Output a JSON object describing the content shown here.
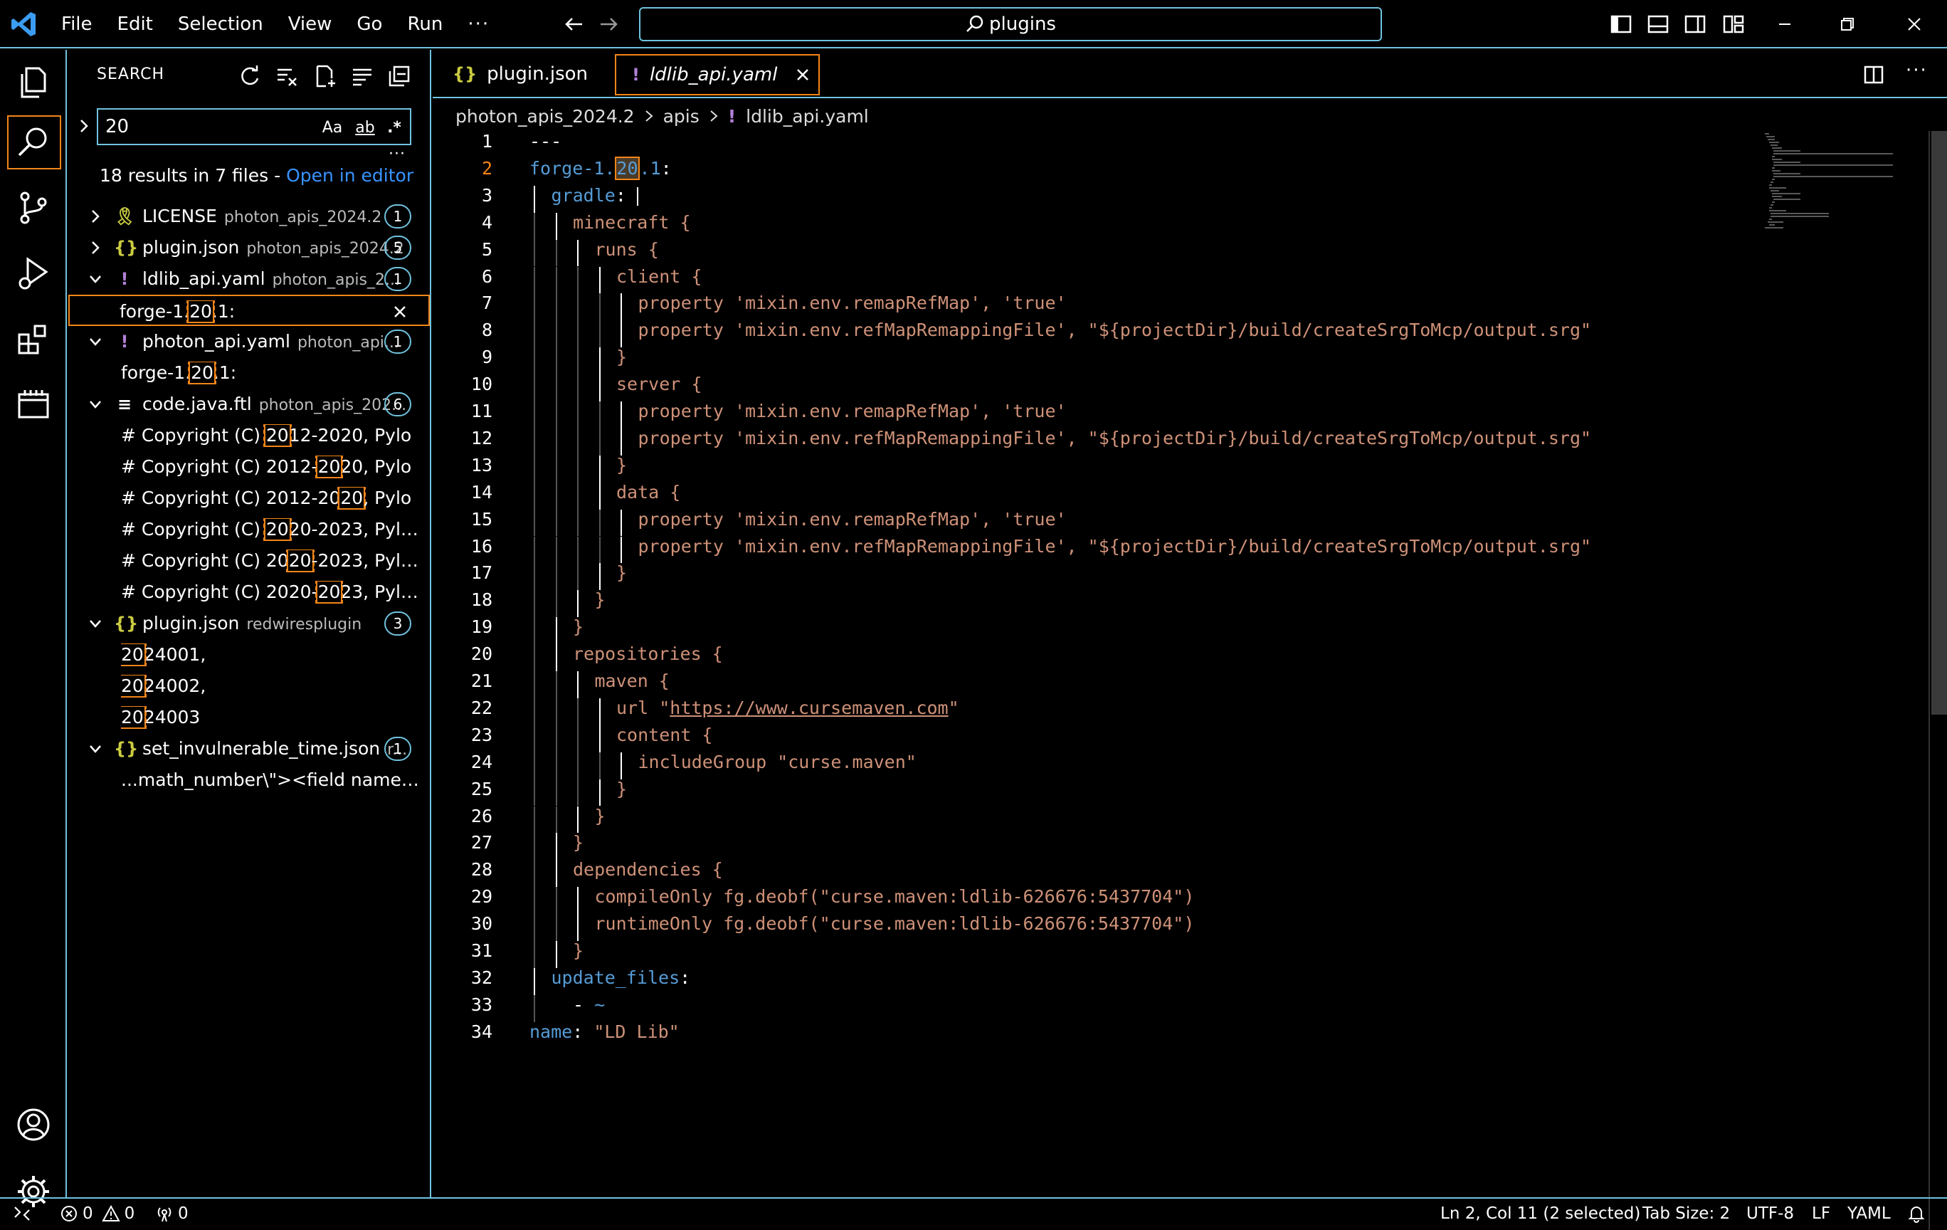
{
  "titlebar": {
    "menu": [
      "File",
      "Edit",
      "Selection",
      "View",
      "Go",
      "Run"
    ],
    "more": "···",
    "command_center": "plugins"
  },
  "sidebar": {
    "title": "SEARCH",
    "search": {
      "value": "20",
      "opt_case": "Aa",
      "opt_word": "ab",
      "opt_regex": ".*"
    },
    "more": "···",
    "summary": "18 results in 7 files - ",
    "open_in_editor": "Open in editor",
    "results": [
      {
        "type": "file",
        "icon": "license",
        "name": "LICENSE",
        "path": "photon_apis_2024.2",
        "count": "1",
        "expanded": false
      },
      {
        "type": "file",
        "icon": "json",
        "name": "plugin.json",
        "path": "photon_apis_2024.2",
        "count": "5",
        "expanded": false
      },
      {
        "type": "file",
        "icon": "yaml",
        "name": "ldlib_api.yaml",
        "path": "photon_apis_2...",
        "count": "1",
        "expanded": true
      },
      {
        "type": "match",
        "pre": "forge-1.",
        "hit": "20",
        "post": ".1:",
        "selected": true
      },
      {
        "type": "file",
        "icon": "yaml",
        "name": "photon_api.yaml",
        "path": "photon_api...",
        "count": "1",
        "expanded": true
      },
      {
        "type": "match",
        "pre": "forge-1.",
        "hit": "20",
        "post": ".1:"
      },
      {
        "type": "file",
        "icon": "text",
        "name": "code.java.ftl",
        "path": "photon_apis_202...",
        "count": "6",
        "expanded": true
      },
      {
        "type": "match",
        "pre": "# Copyright (C) ",
        "hit": "20",
        "post": "12-2020, Pylo"
      },
      {
        "type": "match",
        "pre": "# Copyright (C) 2012-",
        "hit": "20",
        "post": "20, Pylo"
      },
      {
        "type": "match",
        "pre": "# Copyright (C) 2012-20",
        "hit": "20",
        "post": ", Pylo"
      },
      {
        "type": "match",
        "pre": "# Copyright (C) ",
        "hit": "20",
        "post": "20-2023, Pylo, op..."
      },
      {
        "type": "match",
        "pre": "# Copyright (C) 20",
        "hit": "20",
        "post": "-2023, Pylo, op..."
      },
      {
        "type": "match",
        "pre": "# Copyright (C) 2020-",
        "hit": "20",
        "post": "23, Pylo, op..."
      },
      {
        "type": "file",
        "icon": "json",
        "name": "plugin.json",
        "path": "redwiresplugin",
        "count": "3",
        "expanded": true
      },
      {
        "type": "match",
        "pre": "",
        "hit": "20",
        "post": "24001,"
      },
      {
        "type": "match",
        "pre": "",
        "hit": "20",
        "post": "24002,"
      },
      {
        "type": "match",
        "pre": "",
        "hit": "20",
        "post": "24003"
      },
      {
        "type": "file",
        "icon": "json",
        "name": "set_invulnerable_time.json",
        "path": "r...",
        "count": "1",
        "expanded": true
      },
      {
        "type": "match",
        "pre": "...math_number\\\"><field name=\\\"N...",
        "hit": "",
        "post": ""
      }
    ]
  },
  "editor": {
    "tabs": [
      {
        "icon": "{}",
        "label": "plugin.json"
      },
      {
        "icon": "!",
        "label": "ldlib_api.yaml"
      }
    ],
    "more": "···",
    "breadcrumb": [
      "photon_apis_2024.2",
      "apis",
      "ldlib_api.yaml"
    ],
    "breadcrumb_icon": "!",
    "lines": [
      "---",
      "forge-1.20.1:",
      "gradle: |",
      "minecraft {",
      "runs {",
      "client {",
      "property 'mixin.env.remapRefMap', 'true'",
      "property 'mixin.env.refMapRemappingFile', \"${projectDir}/build/createSrgToMcp/output.srg\"",
      "}",
      "server {",
      "property 'mixin.env.remapRefMap', 'true'",
      "property 'mixin.env.refMapRemappingFile', \"${projectDir}/build/createSrgToMcp/output.srg\"",
      "}",
      "data {",
      "property 'mixin.env.remapRefMap', 'true'",
      "property 'mixin.env.refMapRemappingFile', \"${projectDir}/build/createSrgToMcp/output.srg\"",
      "}",
      "}",
      "}",
      "repositories {",
      "maven {",
      "url \"https://www.cursemaven.com\"",
      "content {",
      "includeGroup \"curse.maven\"",
      "}",
      "}",
      "}",
      "dependencies {",
      "compileOnly fg.deobf(\"curse.maven:ldlib-626676:5437704\")",
      "runtimeOnly fg.deobf(\"curse.maven:ldlib-626676:5437704\")",
      "}",
      "update_files:",
      "- ~",
      "name: \"LD Lib\""
    ]
  },
  "statusbar": {
    "errors": "0",
    "warnings": "0",
    "ports": "0",
    "position": "Ln 2, Col 11 (2 selected)",
    "tab_size": "Tab Size: 2",
    "encoding": "UTF-8",
    "eol": "LF",
    "language": "YAML"
  },
  "colors": {
    "accent_border": "#6fc3df",
    "focus": "#f38518",
    "link": "#3794ff",
    "keyword": "#569cd6",
    "string": "#ce9178",
    "yaml_icon": "#b180d7",
    "json_icon": "#cbcb41"
  }
}
